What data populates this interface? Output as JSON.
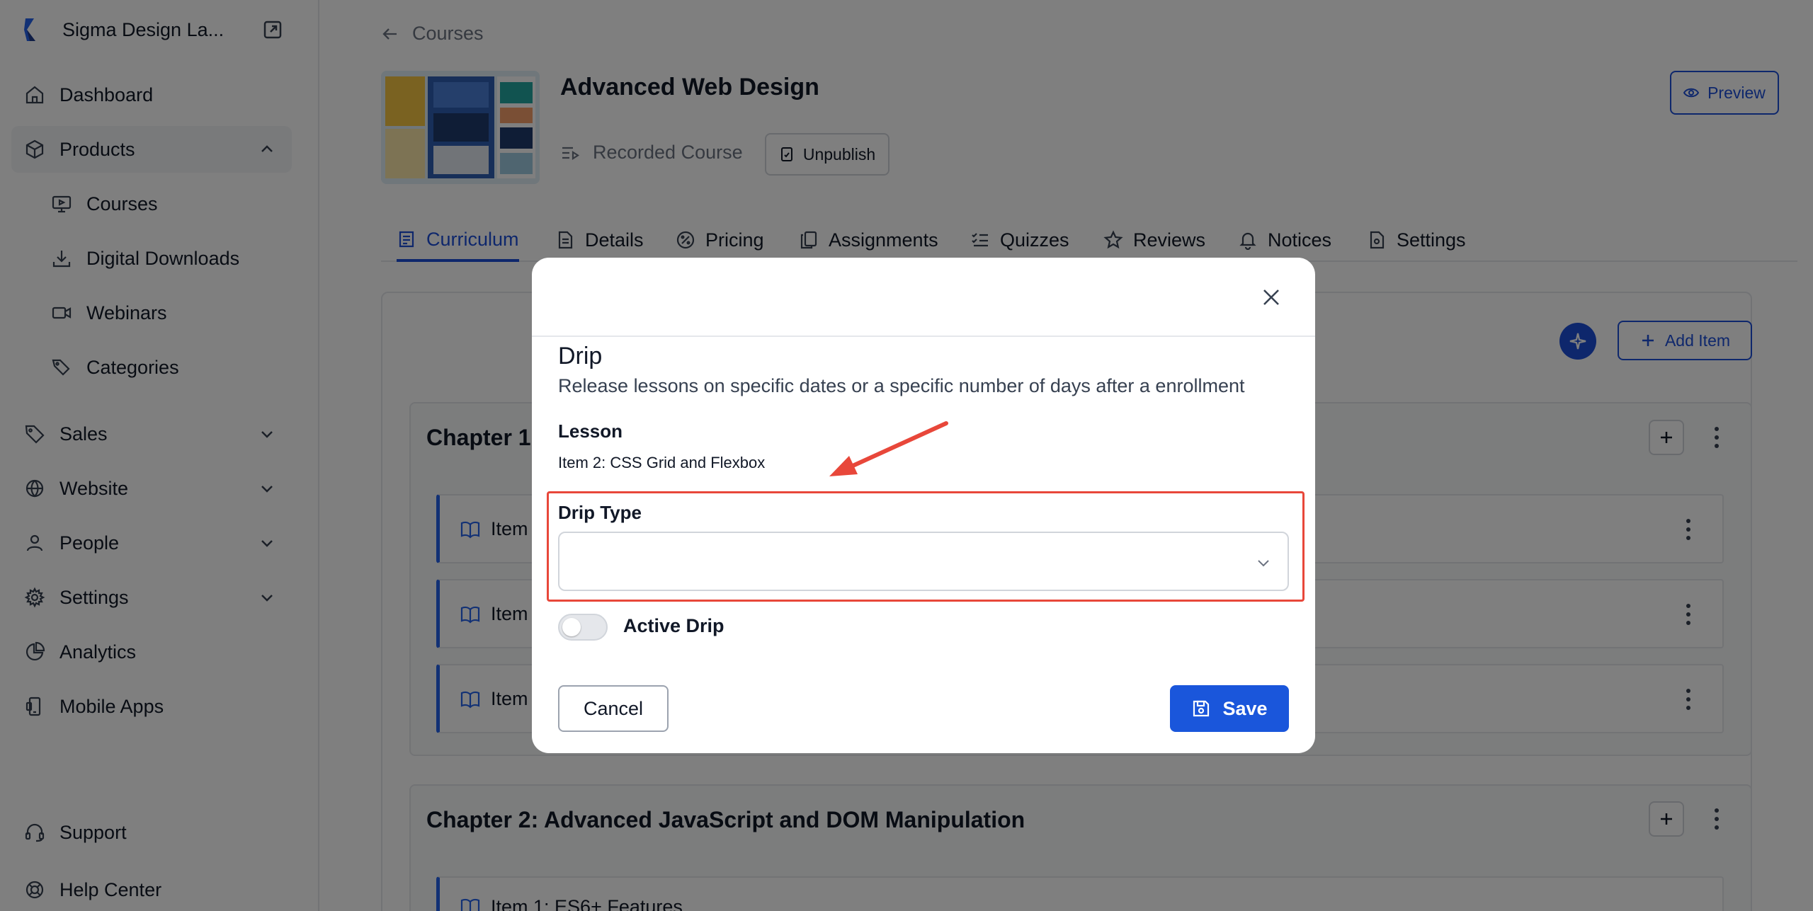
{
  "sidebar": {
    "brand": "Sigma Design La...",
    "items": {
      "dashboard": "Dashboard",
      "products": "Products",
      "courses": "Courses",
      "digital_downloads": "Digital Downloads",
      "webinars": "Webinars",
      "categories": "Categories",
      "sales": "Sales",
      "website": "Website",
      "people": "People",
      "settings": "Settings",
      "analytics": "Analytics",
      "mobile_apps": "Mobile Apps",
      "support": "Support",
      "help_center": "Help Center"
    }
  },
  "header": {
    "breadcrumb": "Courses",
    "course_title": "Advanced Web Design",
    "course_type": "Recorded Course",
    "unpublish": "Unpublish",
    "preview": "Preview"
  },
  "tabs": {
    "curriculum": "Curriculum",
    "details": "Details",
    "pricing": "Pricing",
    "assignments": "Assignments",
    "quizzes": "Quizzes",
    "reviews": "Reviews",
    "notices": "Notices",
    "settings": "Settings"
  },
  "curriculum": {
    "add_item": "Add Item",
    "chapter1_title": "Chapter 1",
    "chapter1_items": [
      "Item",
      "Item",
      "Item"
    ],
    "chapter2_title": "Chapter 2: Advanced JavaScript and DOM Manipulation",
    "chapter2_item1": "Item 1: ES6+ Features"
  },
  "modal": {
    "title": "Drip",
    "description": "Release lessons on specific dates or a specific number of days after a enrollment",
    "lesson_label": "Lesson",
    "lesson_value": "Item 2: CSS Grid and Flexbox",
    "drip_type_label": "Drip Type",
    "drip_type_value": "",
    "active_drip_label": "Active Drip",
    "active_drip_on": false,
    "cancel": "Cancel",
    "save": "Save"
  },
  "colors": {
    "accent": "#1a56db",
    "highlight": "#e8473a"
  }
}
